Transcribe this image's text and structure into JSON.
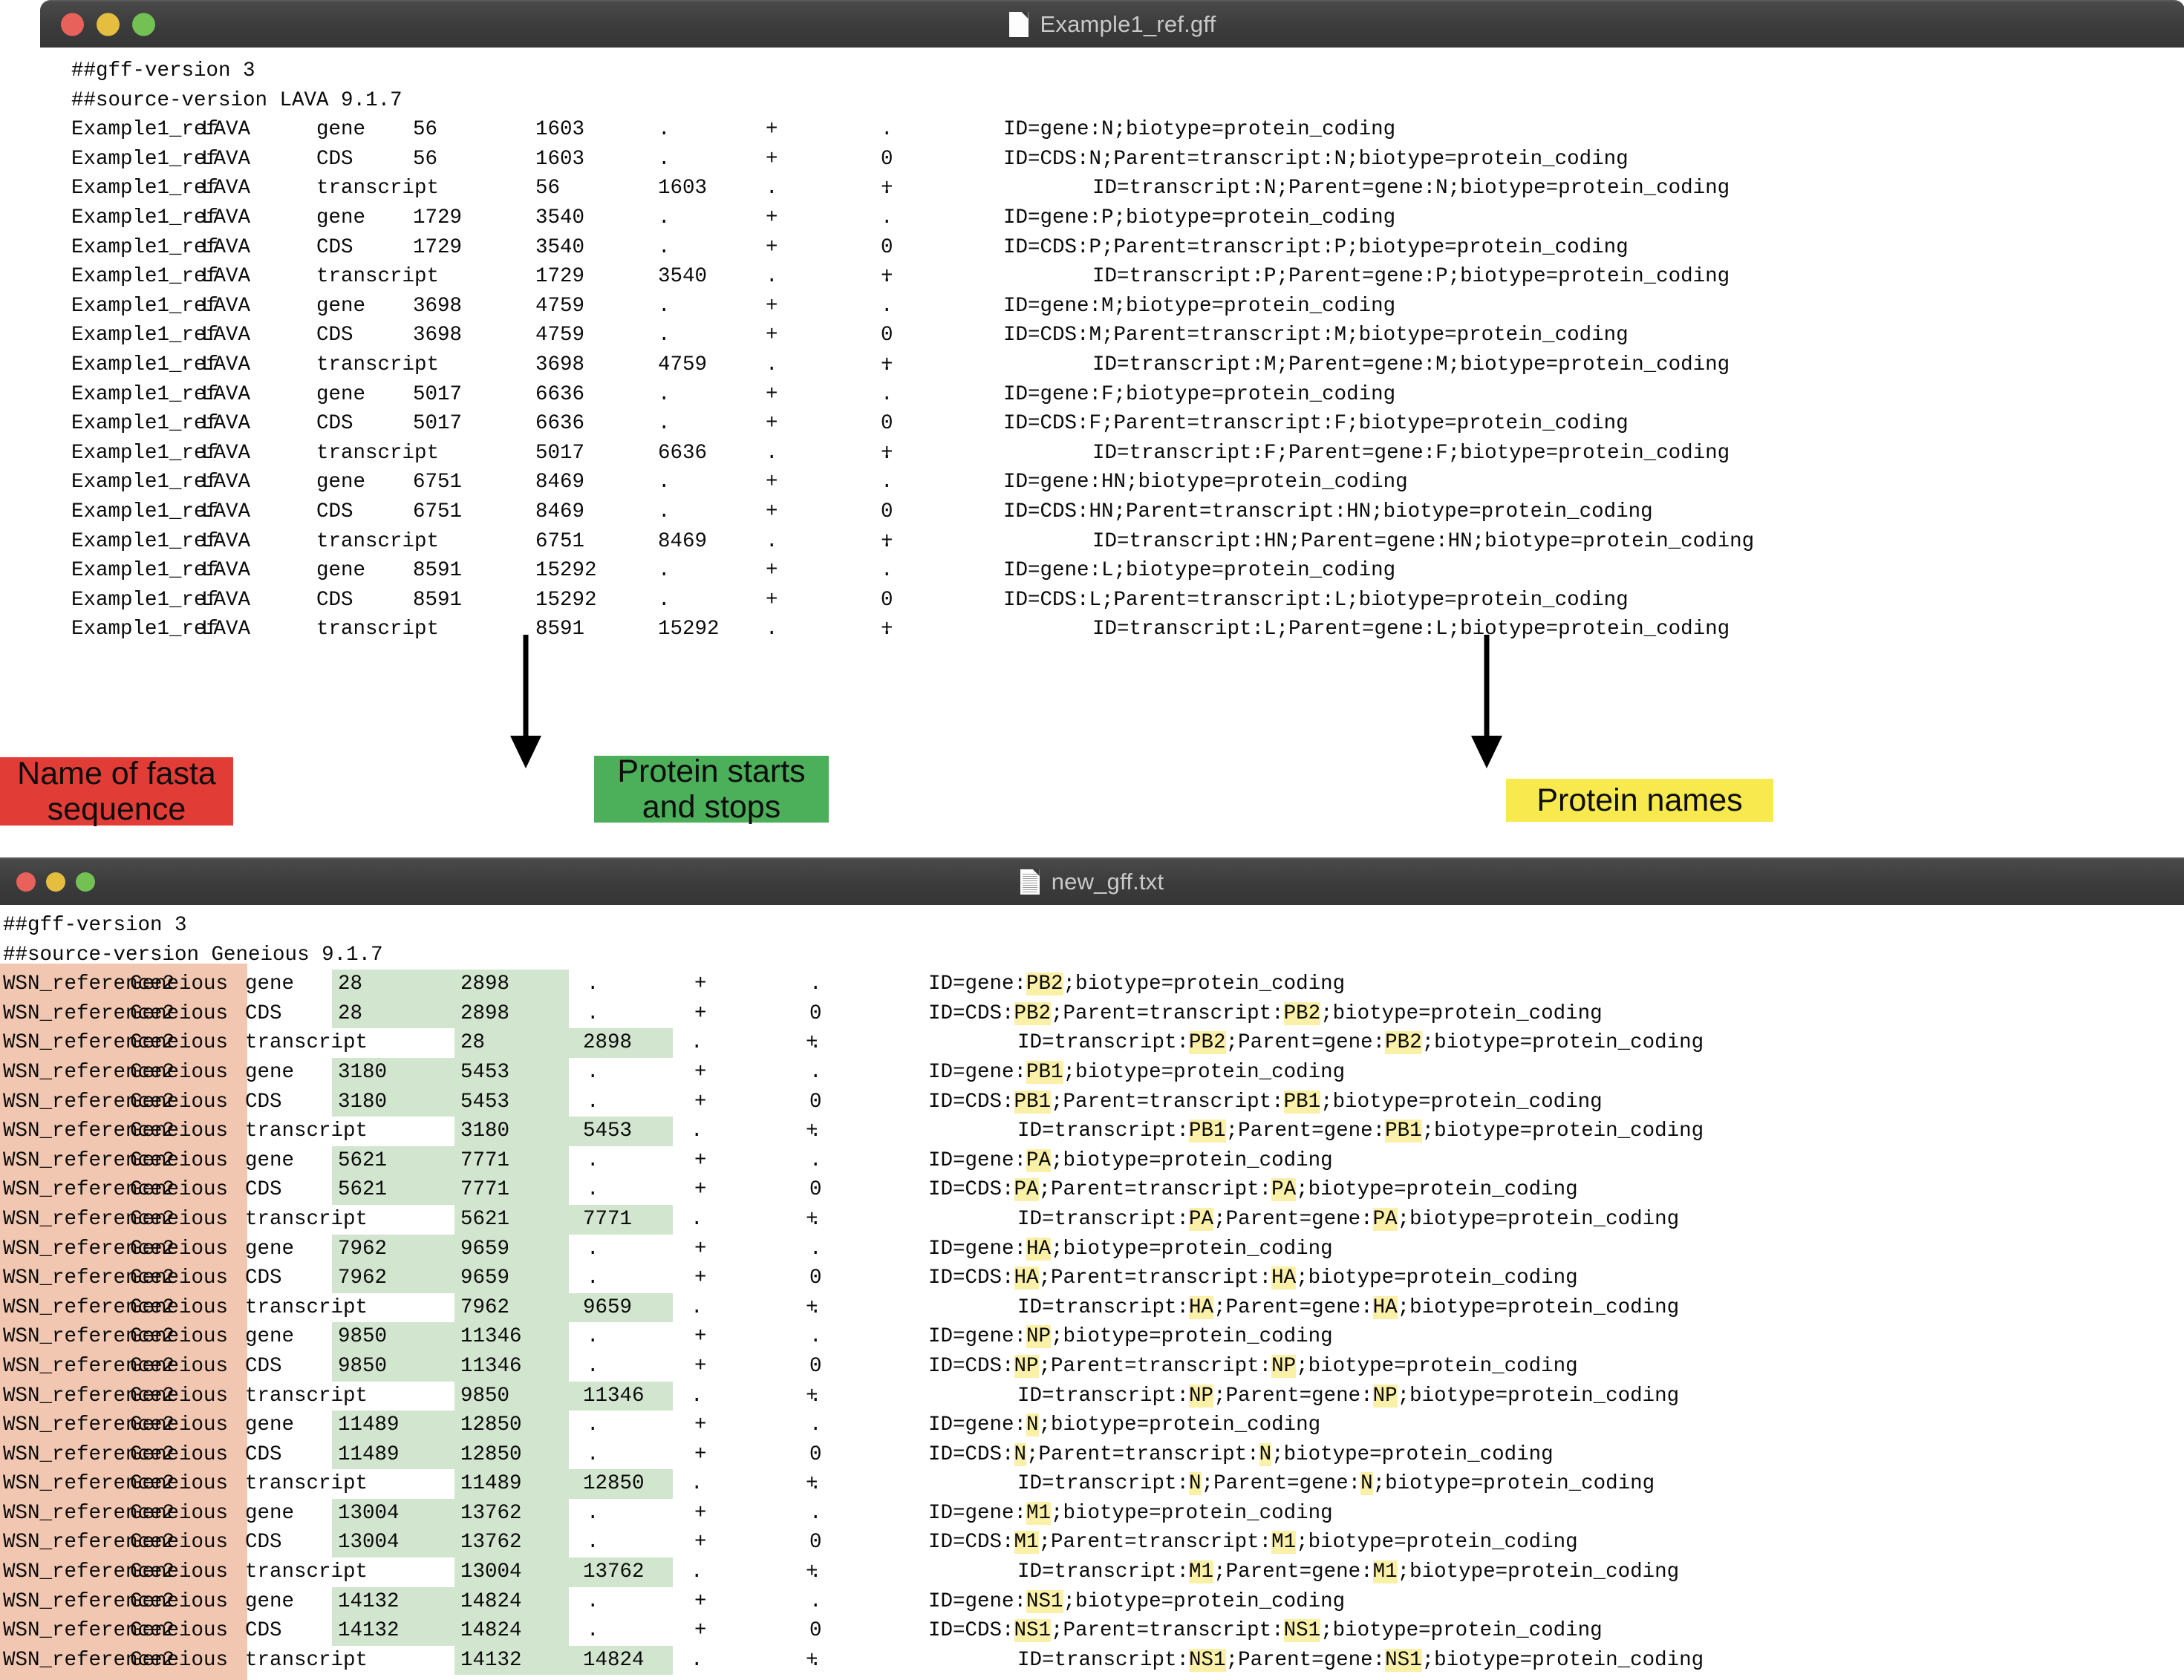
{
  "windows": {
    "top": {
      "title": "Example1_ref.gff",
      "icon": "document-icon",
      "traffic_lights": [
        "close-button",
        "minimize-button",
        "maximize-button"
      ],
      "header_lines": [
        "##gff-version 3",
        "##source-version LAVA 9.1.7"
      ],
      "seqid": "Example1_ref",
      "source": "LAVA",
      "rows": [
        {
          "type": "gene",
          "start": "56",
          "end": "1603",
          "score": ".",
          "strand": "+",
          "phase": ".",
          "attrs": "ID=gene:N;biotype=protein_coding"
        },
        {
          "type": "CDS",
          "start": "56",
          "end": "1603",
          "score": ".",
          "strand": "+",
          "phase": "0",
          "attrs": "ID=CDS:N;Parent=transcript:N;biotype=protein_coding"
        },
        {
          "type": "transcript",
          "start": "56",
          "end": "1603",
          "score": ".",
          "strand": "+",
          "phase": ".",
          "attrs": "ID=transcript:N;Parent=gene:N;biotype=protein_coding"
        },
        {
          "type": "gene",
          "start": "1729",
          "end": "3540",
          "score": ".",
          "strand": "+",
          "phase": ".",
          "attrs": "ID=gene:P;biotype=protein_coding"
        },
        {
          "type": "CDS",
          "start": "1729",
          "end": "3540",
          "score": ".",
          "strand": "+",
          "phase": "0",
          "attrs": "ID=CDS:P;Parent=transcript:P;biotype=protein_coding"
        },
        {
          "type": "transcript",
          "start": "1729",
          "end": "3540",
          "score": ".",
          "strand": "+",
          "phase": ".",
          "attrs": "ID=transcript:P;Parent=gene:P;biotype=protein_coding"
        },
        {
          "type": "gene",
          "start": "3698",
          "end": "4759",
          "score": ".",
          "strand": "+",
          "phase": ".",
          "attrs": "ID=gene:M;biotype=protein_coding"
        },
        {
          "type": "CDS",
          "start": "3698",
          "end": "4759",
          "score": ".",
          "strand": "+",
          "phase": "0",
          "attrs": "ID=CDS:M;Parent=transcript:M;biotype=protein_coding"
        },
        {
          "type": "transcript",
          "start": "3698",
          "end": "4759",
          "score": ".",
          "strand": "+",
          "phase": ".",
          "attrs": "ID=transcript:M;Parent=gene:M;biotype=protein_coding"
        },
        {
          "type": "gene",
          "start": "5017",
          "end": "6636",
          "score": ".",
          "strand": "+",
          "phase": ".",
          "attrs": "ID=gene:F;biotype=protein_coding"
        },
        {
          "type": "CDS",
          "start": "5017",
          "end": "6636",
          "score": ".",
          "strand": "+",
          "phase": "0",
          "attrs": "ID=CDS:F;Parent=transcript:F;biotype=protein_coding"
        },
        {
          "type": "transcript",
          "start": "5017",
          "end": "6636",
          "score": ".",
          "strand": "+",
          "phase": ".",
          "attrs": "ID=transcript:F;Parent=gene:F;biotype=protein_coding"
        },
        {
          "type": "gene",
          "start": "6751",
          "end": "8469",
          "score": ".",
          "strand": "+",
          "phase": ".",
          "attrs": "ID=gene:HN;biotype=protein_coding"
        },
        {
          "type": "CDS",
          "start": "6751",
          "end": "8469",
          "score": ".",
          "strand": "+",
          "phase": "0",
          "attrs": "ID=CDS:HN;Parent=transcript:HN;biotype=protein_coding"
        },
        {
          "type": "transcript",
          "start": "6751",
          "end": "8469",
          "score": ".",
          "strand": "+",
          "phase": ".",
          "attrs": "ID=transcript:HN;Parent=gene:HN;biotype=protein_coding"
        },
        {
          "type": "gene",
          "start": "8591",
          "end": "15292",
          "score": ".",
          "strand": "+",
          "phase": ".",
          "attrs": "ID=gene:L;biotype=protein_coding"
        },
        {
          "type": "CDS",
          "start": "8591",
          "end": "15292",
          "score": ".",
          "strand": "+",
          "phase": "0",
          "attrs": "ID=CDS:L;Parent=transcript:L;biotype=protein_coding"
        },
        {
          "type": "transcript",
          "start": "8591",
          "end": "15292",
          "score": ".",
          "strand": "+",
          "phase": ".",
          "attrs": "ID=transcript:L;Parent=gene:L;biotype=protein_coding"
        }
      ]
    },
    "bottom": {
      "title": "new_gff.txt",
      "icon": "text-document-icon",
      "traffic_lights": [
        "close-button",
        "minimize-button",
        "maximize-button"
      ],
      "header_lines": [
        "##gff-version 3",
        "##source-version Geneious 9.1.7"
      ],
      "seqid": "WSN_reference2",
      "source": "Geneious",
      "rows": [
        {
          "type": "gene",
          "start": "28",
          "end": "2898",
          "score": ".",
          "strand": "+",
          "phase": ".",
          "protein": "PB2"
        },
        {
          "type": "CDS",
          "start": "28",
          "end": "2898",
          "score": ".",
          "strand": "+",
          "phase": "0",
          "protein": "PB2"
        },
        {
          "type": "transcript",
          "start": "28",
          "end": "2898",
          "score": ".",
          "strand": "+",
          "phase": ".",
          "protein": "PB2"
        },
        {
          "type": "gene",
          "start": "3180",
          "end": "5453",
          "score": ".",
          "strand": "+",
          "phase": ".",
          "protein": "PB1"
        },
        {
          "type": "CDS",
          "start": "3180",
          "end": "5453",
          "score": ".",
          "strand": "+",
          "phase": "0",
          "protein": "PB1"
        },
        {
          "type": "transcript",
          "start": "3180",
          "end": "5453",
          "score": ".",
          "strand": "+",
          "phase": ".",
          "protein": "PB1"
        },
        {
          "type": "gene",
          "start": "5621",
          "end": "7771",
          "score": ".",
          "strand": "+",
          "phase": ".",
          "protein": "PA"
        },
        {
          "type": "CDS",
          "start": "5621",
          "end": "7771",
          "score": ".",
          "strand": "+",
          "phase": "0",
          "protein": "PA"
        },
        {
          "type": "transcript",
          "start": "5621",
          "end": "7771",
          "score": ".",
          "strand": "+",
          "phase": ".",
          "protein": "PA"
        },
        {
          "type": "gene",
          "start": "7962",
          "end": "9659",
          "score": ".",
          "strand": "+",
          "phase": ".",
          "protein": "HA"
        },
        {
          "type": "CDS",
          "start": "7962",
          "end": "9659",
          "score": ".",
          "strand": "+",
          "phase": "0",
          "protein": "HA"
        },
        {
          "type": "transcript",
          "start": "7962",
          "end": "9659",
          "score": ".",
          "strand": "+",
          "phase": ".",
          "protein": "HA"
        },
        {
          "type": "gene",
          "start": "9850",
          "end": "11346",
          "score": ".",
          "strand": "+",
          "phase": ".",
          "protein": "NP"
        },
        {
          "type": "CDS",
          "start": "9850",
          "end": "11346",
          "score": ".",
          "strand": "+",
          "phase": "0",
          "protein": "NP"
        },
        {
          "type": "transcript",
          "start": "9850",
          "end": "11346",
          "score": ".",
          "strand": "+",
          "phase": ".",
          "protein": "NP"
        },
        {
          "type": "gene",
          "start": "11489",
          "end": "12850",
          "score": ".",
          "strand": "+",
          "phase": ".",
          "protein": "N"
        },
        {
          "type": "CDS",
          "start": "11489",
          "end": "12850",
          "score": ".",
          "strand": "+",
          "phase": "0",
          "protein": "N"
        },
        {
          "type": "transcript",
          "start": "11489",
          "end": "12850",
          "score": ".",
          "strand": "+",
          "phase": ".",
          "protein": "N"
        },
        {
          "type": "gene",
          "start": "13004",
          "end": "13762",
          "score": ".",
          "strand": "+",
          "phase": ".",
          "protein": "M1"
        },
        {
          "type": "CDS",
          "start": "13004",
          "end": "13762",
          "score": ".",
          "strand": "+",
          "phase": "0",
          "protein": "M1"
        },
        {
          "type": "transcript",
          "start": "13004",
          "end": "13762",
          "score": ".",
          "strand": "+",
          "phase": ".",
          "protein": "M1"
        },
        {
          "type": "gene",
          "start": "14132",
          "end": "14824",
          "score": ".",
          "strand": "+",
          "phase": ".",
          "protein": "NS1"
        },
        {
          "type": "CDS",
          "start": "14132",
          "end": "14824",
          "score": ".",
          "strand": "+",
          "phase": "0",
          "protein": "NS1"
        },
        {
          "type": "transcript",
          "start": "14132",
          "end": "14824",
          "score": ".",
          "strand": "+",
          "phase": ".",
          "protein": "NS1"
        }
      ]
    }
  },
  "attr_templates": {
    "gene_prefix": "ID=gene:",
    "gene_suffix": ";biotype=protein_coding",
    "cds_prefix": "ID=CDS:",
    "cds_mid": ";Parent=transcript:",
    "cds_suffix": ";biotype=protein_coding",
    "transcript_lead": ".",
    "transcript_prefix": "ID=transcript:",
    "transcript_mid": ";Parent=gene:",
    "transcript_suffix": ";biotype=protein_coding"
  },
  "callouts": [
    {
      "id": "fasta-name-callout",
      "label": "Name of fasta\nsequence",
      "color": "#e23c36",
      "text_color": "#0d0d0d"
    },
    {
      "id": "protein-coords-callout",
      "label": "Protein starts\nand stops",
      "color": "#4caf59",
      "text_color": "#0d0d0d"
    },
    {
      "id": "protein-names-callout",
      "label": "Protein names",
      "color": "#f7e94e",
      "text_color": "#0d0d0d"
    }
  ],
  "arrows": [
    {
      "id": "arrow-to-protein-coords"
    },
    {
      "id": "arrow-to-protein-names"
    }
  ],
  "colors": {
    "highlight_green": "#d2e5cf",
    "highlight_salmon": "#f2c7b1",
    "highlight_yellow": "#fbf0a8",
    "titlebar": "#3b3b3b",
    "title_text": "#c9c9c9"
  }
}
